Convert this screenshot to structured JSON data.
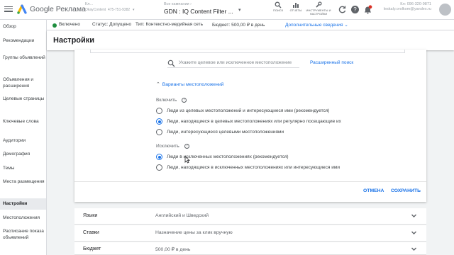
{
  "header": {
    "brand": "Google Реклама",
    "account": {
      "label": "Кл...",
      "name": "OkayContent",
      "id": "475-751-9382"
    },
    "breadcrumb": {
      "top": "Все кампании ›",
      "campaign": "GDN : IQ Content Filter ..."
    },
    "tools": [
      {
        "label": "ПОИСК",
        "icon": "search-icon"
      },
      {
        "label": "ОТЧЕТЫ",
        "icon": "bar-chart-icon"
      },
      {
        "label": "ИНСТРУМЕНТЫ И НАСТРОЙКИ",
        "icon": "wrench-icon"
      }
    ],
    "user": {
      "line1": "Кл: 096-320-9871",
      "line2": "leskaly.orolkom@yandex.ru"
    }
  },
  "sidebar": {
    "items": [
      {
        "label": "Обзор"
      },
      {
        "label": "Рекомендации"
      },
      {
        "label": "Группы объявлений"
      },
      {
        "label": "Объявления и расширения"
      },
      {
        "label": "Целевые страницы"
      },
      {
        "label": "Ключевые слова"
      },
      {
        "label": "Аудитории"
      },
      {
        "label": "Демография"
      },
      {
        "label": "Темы"
      },
      {
        "label": "Места размещения"
      },
      {
        "label": "Настройки",
        "active": true
      },
      {
        "label": "Местоположения"
      },
      {
        "label": "Расписание показа объявлений"
      }
    ]
  },
  "statusbar": {
    "enabled": "Включено",
    "status": "Статус: Допущено",
    "type": "Тип: Контекстно-медийная сеть",
    "budget": "Бюджет: 500,00 ₽ в день",
    "details": "Дополнительные сведения"
  },
  "page": {
    "title": "Настройки"
  },
  "locations": {
    "search_placeholder": "Укажите целевое или исключенное местоположение",
    "advanced_search": "Расширенный поиск",
    "options_title": "Варианты местоположений",
    "include": {
      "label": "Включить",
      "options": [
        {
          "label": "Люди из целевых местоположений и интересующиеся ими (рекомендуется)",
          "selected": false
        },
        {
          "label": "Люди, находящиеся в целевых местоположениях или регулярно посещающие их",
          "selected": true
        },
        {
          "label": "Люди, интересующиеся целевыми местоположениями",
          "selected": false
        }
      ]
    },
    "exclude": {
      "label": "Исключить",
      "options": [
        {
          "label": "Люди в исключенных местоположениях (рекомендуется)",
          "selected": true
        },
        {
          "label": "Люди, находящиеся в исключенных местоположениях или интересующиеся ими",
          "selected": false
        }
      ]
    },
    "cancel": "ОТМЕНА",
    "save": "СОХРАНИТЬ"
  },
  "settings_rows": [
    {
      "name": "Языки",
      "value": "Английский и Шведский"
    },
    {
      "name": "Ставки",
      "value": "Назначение цены за клик вручную"
    },
    {
      "name": "Бюджет",
      "value": "500,00 ₽ в день"
    }
  ],
  "colors": {
    "accent": "#1a73e8",
    "enabled": "#1e8e3e",
    "background": "#f1f3f4"
  }
}
